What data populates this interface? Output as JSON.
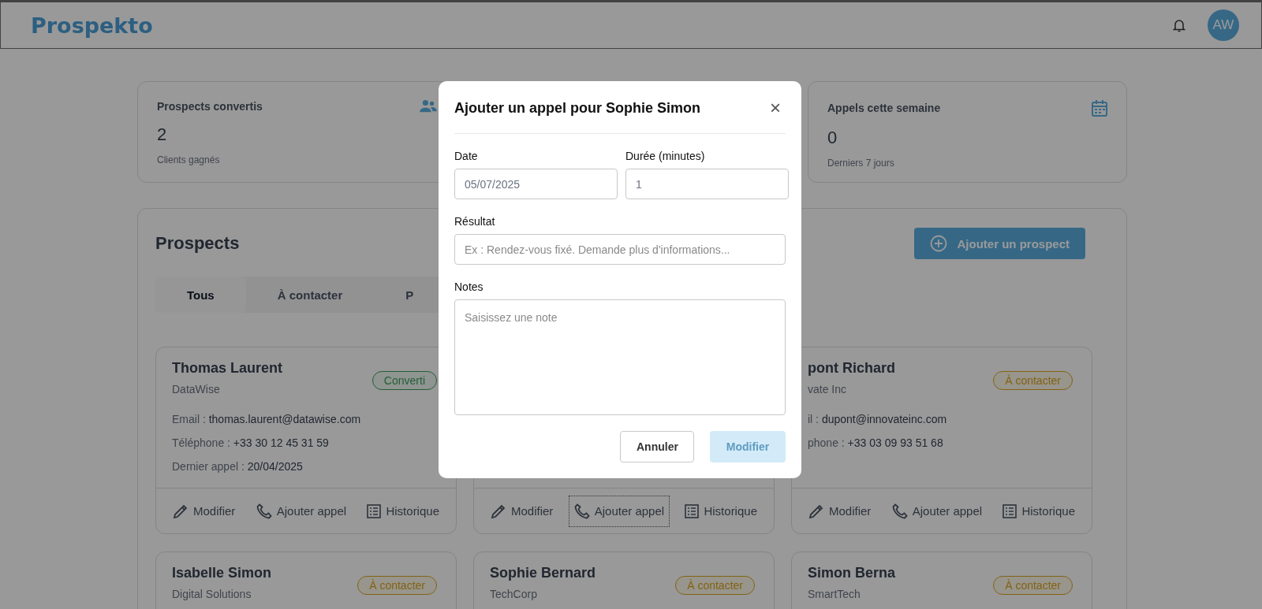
{
  "header": {
    "logo": "Prospekto",
    "avatar": "AW"
  },
  "stats": [
    {
      "title": "Prospects convertis",
      "value": "2",
      "caption": "Clients gagnés"
    },
    {
      "title": "Appels cette semaine",
      "value": "0",
      "caption": "Derniers 7 jours"
    }
  ],
  "prospects": {
    "title": "Prospects",
    "add_button": "Ajouter un prospect",
    "tabs": [
      {
        "label": "Tous",
        "selected": true
      },
      {
        "label": "À contacter",
        "selected": false
      },
      {
        "label": "P",
        "selected": false
      }
    ],
    "cards": [
      {
        "name": "Thomas Laurent",
        "company": "DataWise",
        "status": {
          "label": "Converti",
          "kind": "converted"
        },
        "fields": [
          {
            "label": "Email :",
            "value": "thomas.laurent@datawise.com"
          },
          {
            "label": "Téléphone :",
            "value": "+33 30 12 45 31 59"
          },
          {
            "label": "Dernier appel :",
            "value": "20/04/2025"
          }
        ],
        "actions": [
          {
            "label": "Modifier",
            "focused": false
          },
          {
            "label": "Ajouter appel",
            "focused": false
          },
          {
            "label": "Historique",
            "focused": false
          }
        ]
      },
      {
        "actions": [
          {
            "label": "Modifier",
            "focused": false
          },
          {
            "label": "Ajouter appel",
            "focused": true
          },
          {
            "label": "Historique",
            "focused": false
          }
        ]
      },
      {
        "name": "pont Richard",
        "company": "vate Inc",
        "status": {
          "label": "À contacter",
          "kind": "to_contact"
        },
        "fields": [
          {
            "label": "il :",
            "value": "dupont@innovateinc.com"
          },
          {
            "label": "phone :",
            "value": "+33 03 09 93 51 68"
          }
        ],
        "actions": [
          {
            "label": "Modifier",
            "focused": false
          },
          {
            "label": "Ajouter appel",
            "focused": false
          },
          {
            "label": "Historique",
            "focused": false
          }
        ]
      },
      {
        "name": "Isabelle Simon",
        "company": "Digital Solutions",
        "status": {
          "label": "À contacter",
          "kind": "to_contact"
        }
      },
      {
        "name": "Sophie Bernard",
        "company": "TechCorp",
        "status": {
          "label": "À contacter",
          "kind": "to_contact"
        }
      },
      {
        "name": "Simon Berna",
        "company": "SmartTech",
        "status": {
          "label": "À contacter",
          "kind": "to_contact"
        }
      }
    ]
  },
  "modal": {
    "title": "Ajouter un appel pour Sophie Simon",
    "close": "×",
    "date": {
      "label": "Date",
      "value": "05/07/2025"
    },
    "duration": {
      "label": "Durée (minutes)",
      "value": "1"
    },
    "result": {
      "label": "Résultat",
      "placeholder": "Ex : Rendez-vous fixé. Demande plus d'informations..."
    },
    "notes": {
      "label": "Notes",
      "placeholder": "Saisissez une note"
    },
    "buttons": [
      {
        "label": "Annuler",
        "kind": "secondary",
        "disabled": false
      },
      {
        "label": "Modifier",
        "kind": "primary",
        "disabled": true
      }
    ]
  }
}
